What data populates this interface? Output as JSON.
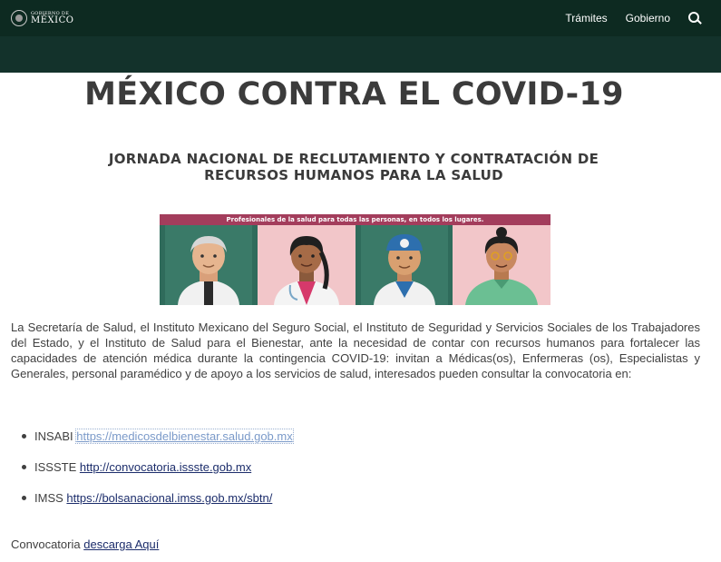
{
  "header": {
    "logo_small": "GOBIERNO DE",
    "logo_big": "MÉXICO",
    "nav": [
      "Trámites",
      "Gobierno"
    ],
    "search_icon": "search-icon"
  },
  "colors": {
    "topbar": "#0d2a21",
    "subbar": "#13322b",
    "banner_header": "#a33d5c",
    "link": "#1c2d6b"
  },
  "main": {
    "title": "MÉXICO CONTRA EL COVID-19",
    "subtitle": "JORNADA NACIONAL DE RECLUTAMIENTO Y CONTRATACIÓN DE RECURSOS HUMANOS PARA LA SALUD",
    "banner_caption": "Profesionales de la salud para todas las personas, en todos los lugares.",
    "intro": "La Secretaría de Salud, el Instituto Mexicano del Seguro Social, el Instituto de Seguridad y Servicios Sociales de los Trabajadores del Estado, y el Instituto de Salud para el Bienestar, ante la necesidad de contar con recursos humanos para fortalecer las capacidades de atención médica durante la contingencia COVID-19: invitan a Médicas(os), Enfermeras (os), Especialistas y Generales, personal paramédico y de apoyo a los servicios de salud, interesados pueden consultar la convocatoria en:",
    "links": [
      {
        "label": "INSABI",
        "url": "https://medicosdelbienestar.salud.gob.mx"
      },
      {
        "label": "ISSSTE",
        "url": "http://convocatoria.issste.gob.mx"
      },
      {
        "label": "IMSS",
        "url": "https://bolsanacional.imss.gob.mx/sbtn/"
      }
    ],
    "convocatoria_label": "Convocatoria",
    "convocatoria_link": "descarga Aquí"
  }
}
